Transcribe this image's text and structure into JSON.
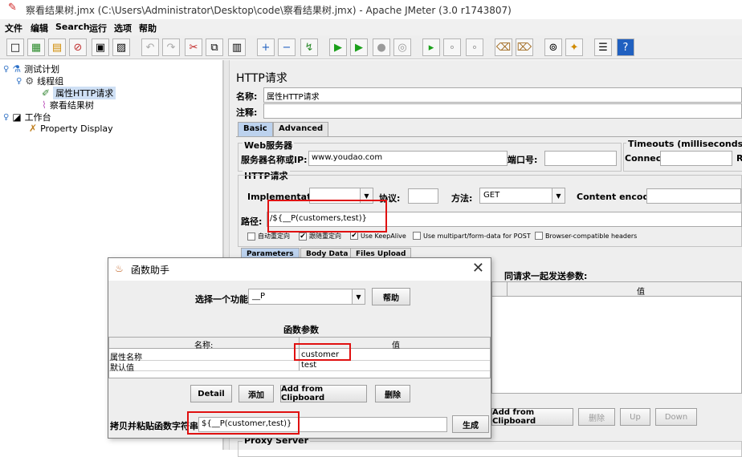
{
  "window": {
    "title": "察看结果树.jmx (C:\\Users\\Administrator\\Desktop\\code\\察看结果树.jmx) - Apache JMeter (3.0 r1743807)"
  },
  "menu": {
    "items": [
      "文件",
      "编辑",
      "Search",
      "运行",
      "选项",
      "帮助"
    ]
  },
  "toolbar": {
    "icons": [
      "new-icon",
      "templates-icon",
      "open-icon",
      "close-icon",
      "save-icon",
      "save-as-icon",
      "undo-icon",
      "redo-icon",
      "cut-icon",
      "copy-icon",
      "paste-icon",
      "expand-icon",
      "collapse-icon",
      "toggle-icon",
      "start-icon",
      "start-no-pause-icon",
      "stop-icon",
      "shutdown-icon",
      "remote-start-icon",
      "remote-stop-icon",
      "remote-shutdown-icon",
      "clear-icon",
      "clear-all-icon",
      "search-icon",
      "reset-search-icon",
      "function-helper-icon",
      "help-icon"
    ]
  },
  "tree": {
    "test_plan": "测试计划",
    "thread_group": "线程组",
    "http_request": "属性HTTP请求",
    "result_tree": "察看结果树",
    "workbench": "工作台",
    "property_display": "Property Display"
  },
  "http_panel": {
    "heading": "HTTP请求",
    "name_label": "名称:",
    "name_value": "属性HTTP请求",
    "comment_label": "注释:",
    "tabs": [
      "Basic",
      "Advanced"
    ],
    "web_server_label": "Web服务器",
    "server_label": "服务器名称或IP:",
    "server_value": "www.youdao.com",
    "port_label": "端口号:",
    "timeouts_label": "Timeouts (milliseconds)",
    "connect_label": "Connect:",
    "response_label_cut": "R",
    "http_request_label": "HTTP请求",
    "implementation_label": "Implementation:",
    "protocol_label": "协议:",
    "method_label": "方法:",
    "method_value": "GET",
    "encoding_label": "Content encoding:",
    "path_label": "路径:",
    "path_value": "/${__P(customers,test)}",
    "checkboxes": [
      {
        "label": "自动重定向",
        "checked": false
      },
      {
        "label": "跟随重定向",
        "checked": true
      },
      {
        "label": "Use KeepAlive",
        "checked": true
      },
      {
        "label": "Use multipart/form-data for POST",
        "checked": false
      },
      {
        "label": "Browser-compatible headers",
        "checked": false
      }
    ],
    "param_tabs": [
      "Parameters",
      "Body Data",
      "Files Upload"
    ],
    "send_params_label": "同请求一起发送参数:",
    "value_col": "值",
    "bottom_buttons": [
      "Add from Clipboard",
      "删除",
      "Up",
      "Down"
    ],
    "proxy_label": "Proxy Server"
  },
  "dialog": {
    "title": "函数助手",
    "choose_label": "选择一个功能",
    "function_value": "__P",
    "help_button": "帮助",
    "params_heading": "函数参数",
    "col_name": "名称:",
    "col_value": "值",
    "rows": [
      {
        "name": "属性名称",
        "value": "customer"
      },
      {
        "name": "默认值",
        "value": "test"
      }
    ],
    "buttons": [
      "Detail",
      "添加",
      "Add from Clipboard",
      "删除"
    ],
    "copy_label": "拷贝并粘贴函数字符串",
    "copy_value": "${__P(customer,test)}",
    "generate_button": "生成"
  },
  "colors": {
    "highlight": "#e01010",
    "selection": "#cfe0f5",
    "active_tab": "#bcd2ee"
  }
}
